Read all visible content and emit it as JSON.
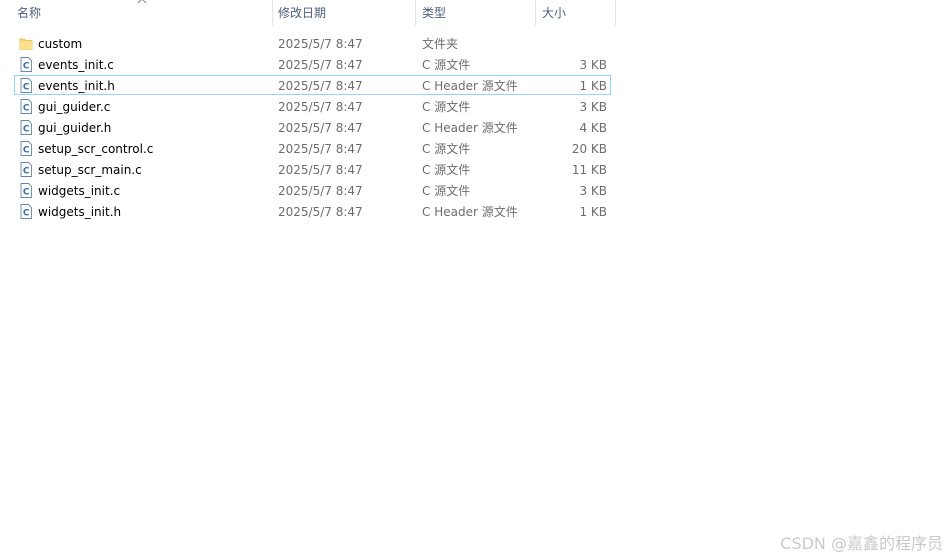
{
  "header": {
    "name": "名称",
    "date": "修改日期",
    "type": "类型",
    "size": "大小"
  },
  "files": [
    {
      "name": "custom",
      "date": "2025/5/7 8:47",
      "type": "文件夹",
      "size": "",
      "icon": "folder-icon"
    },
    {
      "name": "events_init.c",
      "date": "2025/5/7 8:47",
      "type": "C 源文件",
      "size": "3 KB",
      "icon": "c-source-file-icon"
    },
    {
      "name": "events_init.h",
      "date": "2025/5/7 8:47",
      "type": "C Header 源文件",
      "size": "1 KB",
      "icon": "c-header-file-icon"
    },
    {
      "name": "gui_guider.c",
      "date": "2025/5/7 8:47",
      "type": "C 源文件",
      "size": "3 KB",
      "icon": "c-source-file-icon"
    },
    {
      "name": "gui_guider.h",
      "date": "2025/5/7 8:47",
      "type": "C Header 源文件",
      "size": "4 KB",
      "icon": "c-header-file-icon"
    },
    {
      "name": "setup_scr_control.c",
      "date": "2025/5/7 8:47",
      "type": "C 源文件",
      "size": "20 KB",
      "icon": "c-source-file-icon"
    },
    {
      "name": "setup_scr_main.c",
      "date": "2025/5/7 8:47",
      "type": "C 源文件",
      "size": "11 KB",
      "icon": "c-source-file-icon"
    },
    {
      "name": "widgets_init.c",
      "date": "2025/5/7 8:47",
      "type": "C 源文件",
      "size": "3 KB",
      "icon": "c-source-file-icon"
    },
    {
      "name": "widgets_init.h",
      "date": "2025/5/7 8:47",
      "type": "C Header 源文件",
      "size": "1 KB",
      "icon": "c-header-file-icon"
    }
  ],
  "watermark": "CSDN @嘉鑫的程序员",
  "colors": {
    "header_text": "#4c607a",
    "focus_border": "#99d1ff",
    "folder": "#f8d775",
    "c_icon": "#3a6ea5"
  }
}
